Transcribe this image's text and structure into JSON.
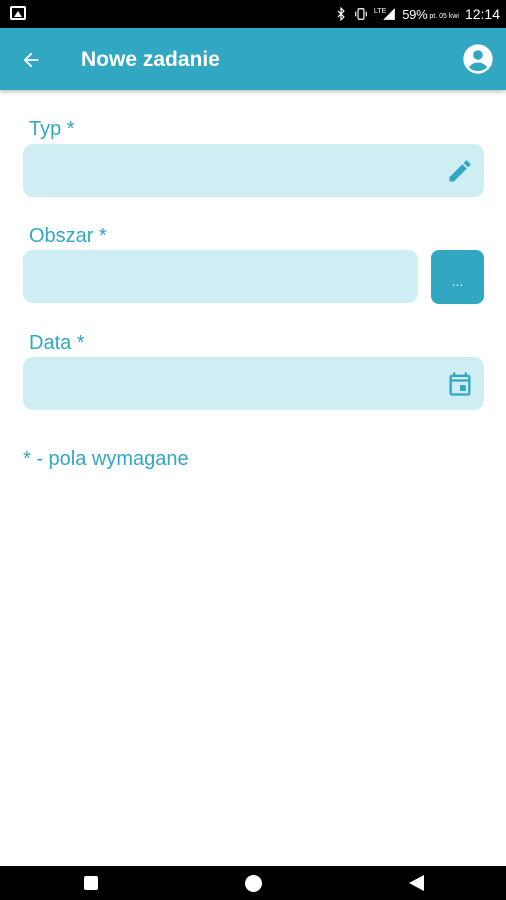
{
  "status_bar": {
    "battery": "59%",
    "date": "pt. 05 kwi",
    "time": "12:14",
    "network": "LTE",
    "icons": [
      "image-icon",
      "bluetooth-icon",
      "vibrate-icon",
      "signal-icon",
      "battery-icon"
    ]
  },
  "app_bar": {
    "title": "Nowe zadanie",
    "back_icon": "arrow-back-icon",
    "account_icon": "account-circle-icon",
    "color": "#31a7c1"
  },
  "form": {
    "fields": [
      {
        "label": "Typ *",
        "value": "",
        "icon": "pencil-icon"
      },
      {
        "label": "Obszar *",
        "value": "",
        "button_label": "..."
      },
      {
        "label": "Data *",
        "value": "",
        "icon": "calendar-icon"
      }
    ],
    "required_note": "* - pola wymagane"
  },
  "colors": {
    "accent": "#31a7c1",
    "field_background": "#cfeef3"
  },
  "nav_bar": {
    "icons": [
      "recents-icon",
      "home-icon",
      "back-icon"
    ]
  }
}
